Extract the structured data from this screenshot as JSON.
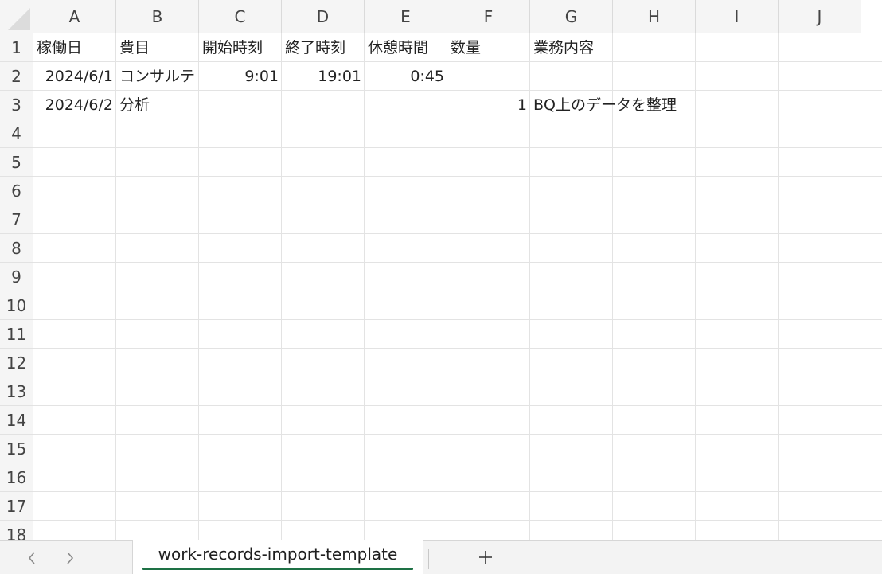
{
  "columns": [
    "A",
    "B",
    "C",
    "D",
    "E",
    "F",
    "G",
    "H",
    "I",
    "J"
  ],
  "rows": [
    "1",
    "2",
    "3",
    "4",
    "5",
    "6",
    "7",
    "8",
    "9",
    "10",
    "11",
    "12",
    "13",
    "14",
    "15",
    "16",
    "17",
    "18"
  ],
  "cells": [
    {
      "ref": "A1",
      "value": "稼働日",
      "align": "left"
    },
    {
      "ref": "B1",
      "value": "費目",
      "align": "left"
    },
    {
      "ref": "C1",
      "value": "開始時刻",
      "align": "left"
    },
    {
      "ref": "D1",
      "value": "終了時刻",
      "align": "left"
    },
    {
      "ref": "E1",
      "value": "休憩時間",
      "align": "left"
    },
    {
      "ref": "F1",
      "value": "数量",
      "align": "left"
    },
    {
      "ref": "G1",
      "value": "業務内容",
      "align": "left"
    },
    {
      "ref": "A2",
      "value": "2024/6/1",
      "align": "right"
    },
    {
      "ref": "B2",
      "value": "コンサルテ",
      "align": "left"
    },
    {
      "ref": "C2",
      "value": "9:01",
      "align": "right"
    },
    {
      "ref": "D2",
      "value": "19:01",
      "align": "right"
    },
    {
      "ref": "E2",
      "value": "0:45",
      "align": "right"
    },
    {
      "ref": "A3",
      "value": "2024/6/2",
      "align": "right"
    },
    {
      "ref": "B3",
      "value": "分析",
      "align": "left"
    },
    {
      "ref": "F3",
      "value": "1",
      "align": "right"
    },
    {
      "ref": "G3",
      "value": "BQ上のデータを整理",
      "align": "left",
      "overflow": true
    }
  ],
  "sheet_tabs": [
    {
      "name": "work-records-import-template",
      "active": true
    }
  ],
  "tabbar": {
    "prev_icon": "chevron-left-icon",
    "next_icon": "chevron-right-icon",
    "add_icon": "plus-icon"
  },
  "colors": {
    "accent": "#1e7145",
    "header_bg": "#f5f5f5",
    "gridline": "#e3e3e3"
  }
}
